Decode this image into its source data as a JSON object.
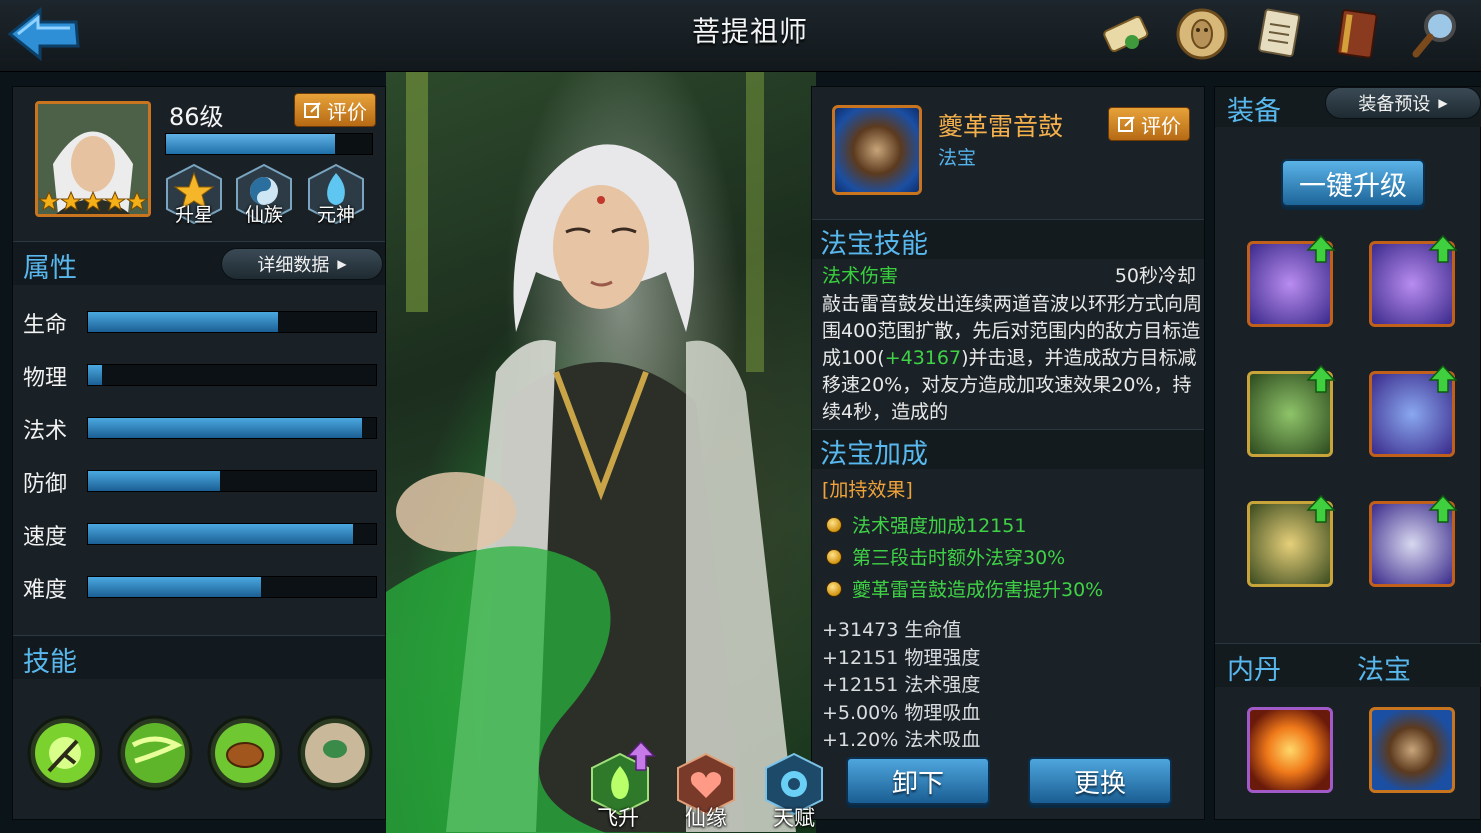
{
  "header": {
    "title": "菩提祖师"
  },
  "hero": {
    "level": "86级",
    "eval_label": "评价",
    "exp_fraction": 0.82,
    "stars": 5,
    "badges": [
      {
        "label": "升星",
        "icon": "star-upgrade-icon"
      },
      {
        "label": "仙族",
        "icon": "yin-yang-icon"
      },
      {
        "label": "元神",
        "icon": "spirit-flame-icon"
      }
    ]
  },
  "attributes": {
    "title": "属性",
    "detail_label": "详细数据",
    "items": [
      {
        "label": "生命",
        "value": 0.66
      },
      {
        "label": "物理",
        "value": 0.05
      },
      {
        "label": "法术",
        "value": 0.95
      },
      {
        "label": "防御",
        "value": 0.46
      },
      {
        "label": "速度",
        "value": 0.92
      },
      {
        "label": "难度",
        "value": 0.6
      }
    ]
  },
  "skills": {
    "title": "技能",
    "icons": [
      "branch-skill-icon",
      "whirlwind-skill-icon",
      "drum-skill-icon",
      "gourd-skill-icon"
    ]
  },
  "item": {
    "name": "夔革雷音鼓",
    "type": "法宝",
    "eval_label": "评价",
    "skill_section": "法宝技能",
    "skill_type": "法术伤害",
    "cooldown": "50秒冷却",
    "desc_1": "敲击雷音鼓发出连续两道音波以环形方式向周围400范围扩散，先后对范围内的敌方目标造成100(",
    "desc_bonus": "+43167",
    "desc_2": ")并击退，并造成敌方目标减移速20%，对友方造成加攻速效果20%，持续4秒，造成的",
    "bonus_section": "法宝加成",
    "bonus_tag": "[加持效果]",
    "bonuses": [
      "法术强度加成12151",
      "第三段击时额外法穿30%",
      "夔革雷音鼓造成伤害提升30%"
    ],
    "stats": [
      "+31473 生命值",
      "+12151 物理强度",
      "+12151 法术强度",
      "+5.00% 物理吸血",
      "+1.20% 法术吸血"
    ],
    "unequip_label": "卸下",
    "replace_label": "更换"
  },
  "equipment": {
    "title": "装备",
    "preset_label": "装备预设",
    "upgrade_label": "一键升级",
    "slots": [
      "weapon-staff-icon",
      "weapon-staff-icon",
      "helmet-icon",
      "robe-icon",
      "boots-icon",
      "talisman-icon"
    ],
    "inner_title": "内丹",
    "treasure_title": "法宝",
    "inner_icon": "fire-orb-icon",
    "treasure_icon": "thunder-drum-icon"
  },
  "bottom_nav": [
    {
      "label": "飞升",
      "icon": "ascend-icon"
    },
    {
      "label": "仙缘",
      "icon": "fate-icon"
    },
    {
      "label": "天赋",
      "icon": "talent-icon"
    }
  ],
  "top_icons": [
    "scroll-icon",
    "coin-mask-icon",
    "notes-icon",
    "book-icon",
    "magnifier-icon"
  ],
  "colors": {
    "accent_blue": "#58b7ec",
    "orange": "#f0a33a",
    "green": "#3fd246"
  }
}
